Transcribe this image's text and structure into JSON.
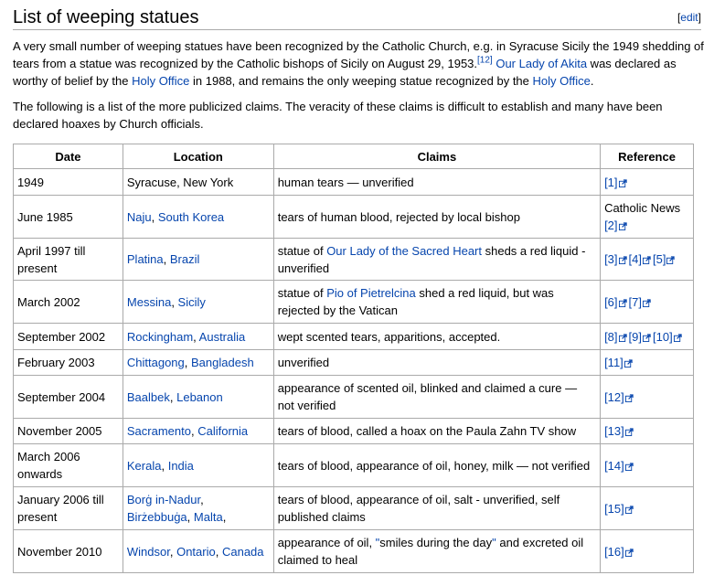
{
  "section": {
    "title": "List of weeping statues",
    "edit_label": "edit"
  },
  "paragraphs": [
    [
      {
        "t": "A very small number of weeping statues have been recognized by the Catholic Church, e.g. in Syracuse Sicily the 1949 shedding of tears from a statue was recognized by the Catholic bishops of Sicily on August 29, 1953."
      },
      {
        "t": "[12]",
        "link": true,
        "sup": true
      },
      {
        "t": " "
      },
      {
        "t": "Our Lady of Akita",
        "link": true
      },
      {
        "t": " was declared as worthy of belief by the "
      },
      {
        "t": "Holy Office",
        "link": true
      },
      {
        "t": " in 1988, and remains the only weeping statue recognized by the "
      },
      {
        "t": "Holy Office",
        "link": true
      },
      {
        "t": "."
      }
    ],
    [
      {
        "t": "The following is a list of the more publicized claims. The veracity of these claims is difficult to establish and many have been declared hoaxes by Church officials."
      }
    ]
  ],
  "table": {
    "headers": [
      "Date",
      "Location",
      "Claims",
      "Reference"
    ],
    "rows": [
      {
        "date": [
          {
            "t": "1949"
          }
        ],
        "location": [
          {
            "t": "Syracuse, New York"
          }
        ],
        "claims": [
          {
            "t": "human tears — unverified"
          }
        ],
        "refs": [
          {
            "t": "[1]",
            "ext": true
          }
        ]
      },
      {
        "date": [
          {
            "t": "June 1985"
          }
        ],
        "location": [
          {
            "t": "Naju",
            "link": true
          },
          {
            "t": ", "
          },
          {
            "t": "South Korea",
            "link": true
          }
        ],
        "claims": [
          {
            "t": "tears of human blood, rejected by local bishop"
          }
        ],
        "refs": [
          {
            "t": "Catholic News "
          },
          {
            "t": "[2]",
            "ext": true
          }
        ]
      },
      {
        "date": [
          {
            "t": "April 1997 till present"
          }
        ],
        "location": [
          {
            "t": "Platina",
            "link": true
          },
          {
            "t": ", "
          },
          {
            "t": "Brazil",
            "link": true
          }
        ],
        "claims": [
          {
            "t": "statue of "
          },
          {
            "t": "Our Lady of the Sacred Heart",
            "link": true
          },
          {
            "t": " sheds a red liquid - unverified"
          }
        ],
        "refs": [
          {
            "t": "[3]",
            "ext": true
          },
          {
            "t": "[4]",
            "ext": true
          },
          {
            "t": "[5]",
            "ext": true
          }
        ]
      },
      {
        "date": [
          {
            "t": "March 2002"
          }
        ],
        "location": [
          {
            "t": "Messina",
            "link": true
          },
          {
            "t": ", "
          },
          {
            "t": "Sicily",
            "link": true
          }
        ],
        "claims": [
          {
            "t": "statue of "
          },
          {
            "t": "Pio of Pietrelcina",
            "link": true
          },
          {
            "t": " shed a red liquid, but was rejected by the Vatican"
          }
        ],
        "refs": [
          {
            "t": "[6]",
            "ext": true
          },
          {
            "t": "[7]",
            "ext": true
          }
        ]
      },
      {
        "date": [
          {
            "t": "September 2002"
          }
        ],
        "location": [
          {
            "t": "Rockingham",
            "link": true
          },
          {
            "t": ", "
          },
          {
            "t": "Australia",
            "link": true
          }
        ],
        "claims": [
          {
            "t": "wept scented tears, apparitions, accepted."
          }
        ],
        "refs": [
          {
            "t": "[8]",
            "ext": true
          },
          {
            "t": "[9]",
            "ext": true
          },
          {
            "t": "[10]",
            "ext": true
          }
        ]
      },
      {
        "date": [
          {
            "t": "February 2003"
          }
        ],
        "location": [
          {
            "t": "Chittagong",
            "link": true
          },
          {
            "t": ", "
          },
          {
            "t": "Bangladesh",
            "link": true
          }
        ],
        "claims": [
          {
            "t": "unverified"
          }
        ],
        "refs": [
          {
            "t": "[11]",
            "ext": true
          }
        ]
      },
      {
        "date": [
          {
            "t": "September 2004"
          }
        ],
        "location": [
          {
            "t": "Baalbek",
            "link": true
          },
          {
            "t": ", "
          },
          {
            "t": "Lebanon",
            "link": true
          }
        ],
        "claims": [
          {
            "t": "appearance of scented oil, blinked and claimed a cure — not verified"
          }
        ],
        "refs": [
          {
            "t": "[12]",
            "ext": true
          }
        ]
      },
      {
        "date": [
          {
            "t": "November 2005"
          }
        ],
        "location": [
          {
            "t": "Sacramento",
            "link": true
          },
          {
            "t": ", "
          },
          {
            "t": "California",
            "link": true
          }
        ],
        "claims": [
          {
            "t": "tears of blood, called a hoax on the Paula Zahn TV show"
          }
        ],
        "refs": [
          {
            "t": "[13]",
            "ext": true
          }
        ]
      },
      {
        "date": [
          {
            "t": "March 2006 onwards"
          }
        ],
        "location": [
          {
            "t": "Kerala",
            "link": true
          },
          {
            "t": ", "
          },
          {
            "t": "India",
            "link": true
          }
        ],
        "claims": [
          {
            "t": "tears of blood, appearance of oil, honey, milk — not verified"
          }
        ],
        "refs": [
          {
            "t": "[14]",
            "ext": true
          }
        ]
      },
      {
        "date": [
          {
            "t": "January 2006 till present"
          }
        ],
        "location": [
          {
            "t": "Borġ in-Nadur",
            "link": true
          },
          {
            "t": ", "
          },
          {
            "t": "Birżebbuġa",
            "link": true
          },
          {
            "t": ", "
          },
          {
            "t": "Malta",
            "link": true
          },
          {
            "t": ","
          }
        ],
        "claims": [
          {
            "t": "tears of blood, appearance of oil, salt - unverified, self published claims"
          }
        ],
        "refs": [
          {
            "t": "[15]",
            "ext": true
          }
        ]
      },
      {
        "date": [
          {
            "t": "November 2010"
          }
        ],
        "location": [
          {
            "t": "Windsor",
            "link": true
          },
          {
            "t": ", "
          },
          {
            "t": "Ontario",
            "link": true
          },
          {
            "t": ", "
          },
          {
            "t": "Canada",
            "link": true
          }
        ],
        "claims": [
          {
            "t": "appearance of oil, "
          },
          {
            "t": "\"",
            "link": true
          },
          {
            "t": "smiles during the day"
          },
          {
            "t": "\"",
            "link": true
          },
          {
            "t": " and excreted oil claimed to heal"
          }
        ],
        "refs": [
          {
            "t": "[16]",
            "ext": true
          }
        ]
      }
    ]
  },
  "colors": {
    "link": "#0645ad",
    "border": "#aaaaaa"
  }
}
